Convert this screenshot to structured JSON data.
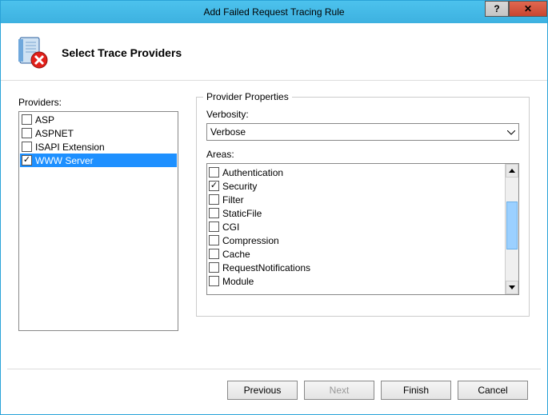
{
  "window": {
    "title": "Add Failed Request Tracing Rule"
  },
  "header": {
    "title": "Select Trace Providers"
  },
  "providers": {
    "label": "Providers:",
    "items": [
      {
        "label": "ASP",
        "checked": false,
        "selected": false
      },
      {
        "label": "ASPNET",
        "checked": false,
        "selected": false
      },
      {
        "label": "ISAPI Extension",
        "checked": false,
        "selected": false
      },
      {
        "label": "WWW Server",
        "checked": true,
        "selected": true
      }
    ]
  },
  "props": {
    "group_label": "Provider Properties",
    "verbosity_label": "Verbosity:",
    "verbosity_value": "Verbose",
    "areas_label": "Areas:",
    "areas": [
      {
        "label": "Authentication",
        "checked": false
      },
      {
        "label": "Security",
        "checked": true
      },
      {
        "label": "Filter",
        "checked": false
      },
      {
        "label": "StaticFile",
        "checked": false
      },
      {
        "label": "CGI",
        "checked": false
      },
      {
        "label": "Compression",
        "checked": false
      },
      {
        "label": "Cache",
        "checked": false
      },
      {
        "label": "RequestNotifications",
        "checked": false
      },
      {
        "label": "Module",
        "checked": false
      }
    ]
  },
  "buttons": {
    "previous": "Previous",
    "next": "Next",
    "finish": "Finish",
    "cancel": "Cancel"
  }
}
